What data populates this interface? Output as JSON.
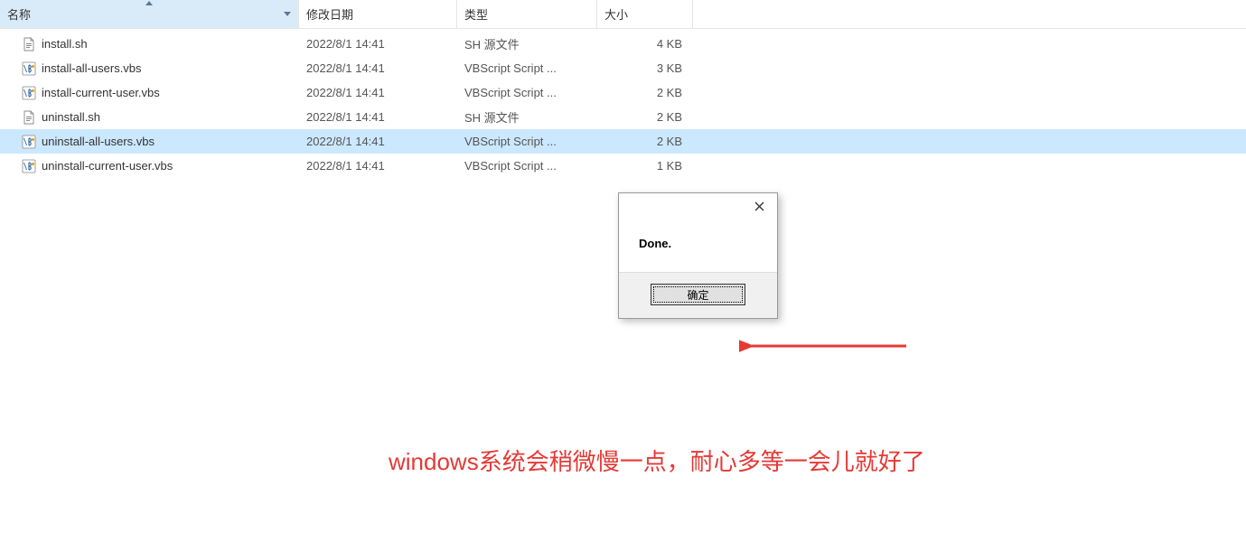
{
  "columns": {
    "name": "名称",
    "date": "修改日期",
    "type": "类型",
    "size": "大小"
  },
  "files": [
    {
      "name": "install.sh",
      "date": "2022/8/1 14:41",
      "type": "SH 源文件",
      "size": "4 KB",
      "icon": "sh",
      "selected": false
    },
    {
      "name": "install-all-users.vbs",
      "date": "2022/8/1 14:41",
      "type": "VBScript Script ...",
      "size": "3 KB",
      "icon": "vbs",
      "selected": false
    },
    {
      "name": "install-current-user.vbs",
      "date": "2022/8/1 14:41",
      "type": "VBScript Script ...",
      "size": "2 KB",
      "icon": "vbs",
      "selected": false
    },
    {
      "name": "uninstall.sh",
      "date": "2022/8/1 14:41",
      "type": "SH 源文件",
      "size": "2 KB",
      "icon": "sh",
      "selected": false
    },
    {
      "name": "uninstall-all-users.vbs",
      "date": "2022/8/1 14:41",
      "type": "VBScript Script ...",
      "size": "2 KB",
      "icon": "vbs",
      "selected": true
    },
    {
      "name": "uninstall-current-user.vbs",
      "date": "2022/8/1 14:41",
      "type": "VBScript Script ...",
      "size": "1 KB",
      "icon": "vbs",
      "selected": false
    }
  ],
  "dialog": {
    "message": "Done.",
    "ok_label": "确定"
  },
  "annotation": "windows系统会稍微慢一点，耐心多等一会儿就好了"
}
